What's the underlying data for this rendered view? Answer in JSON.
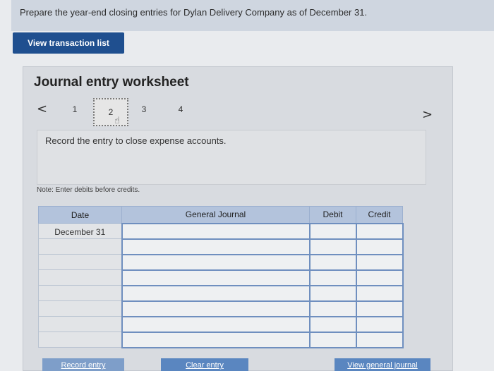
{
  "prompt": "Prepare the year-end closing entries for Dylan Delivery Company as of December 31.",
  "view_transaction_label": "View transaction list",
  "worksheet": {
    "title": "Journal entry worksheet",
    "prev_symbol": "<",
    "next_symbol": ">",
    "steps": [
      "1",
      "2",
      "3",
      "4"
    ],
    "active_step": "2",
    "instruction": "Record the entry to close expense accounts.",
    "note": "Note: Enter debits before credits."
  },
  "table": {
    "headers": {
      "date": "Date",
      "general_journal": "General Journal",
      "debit": "Debit",
      "credit": "Credit"
    },
    "first_date": "December 31"
  },
  "buttons": {
    "record_entry": "Record entry",
    "clear_entry": "Clear entry",
    "view_general_journal": "View general journal"
  },
  "colors": {
    "primary_button": "#1f4f8f",
    "table_header": "#b3c3dc",
    "input_border": "#6f8fbf"
  }
}
